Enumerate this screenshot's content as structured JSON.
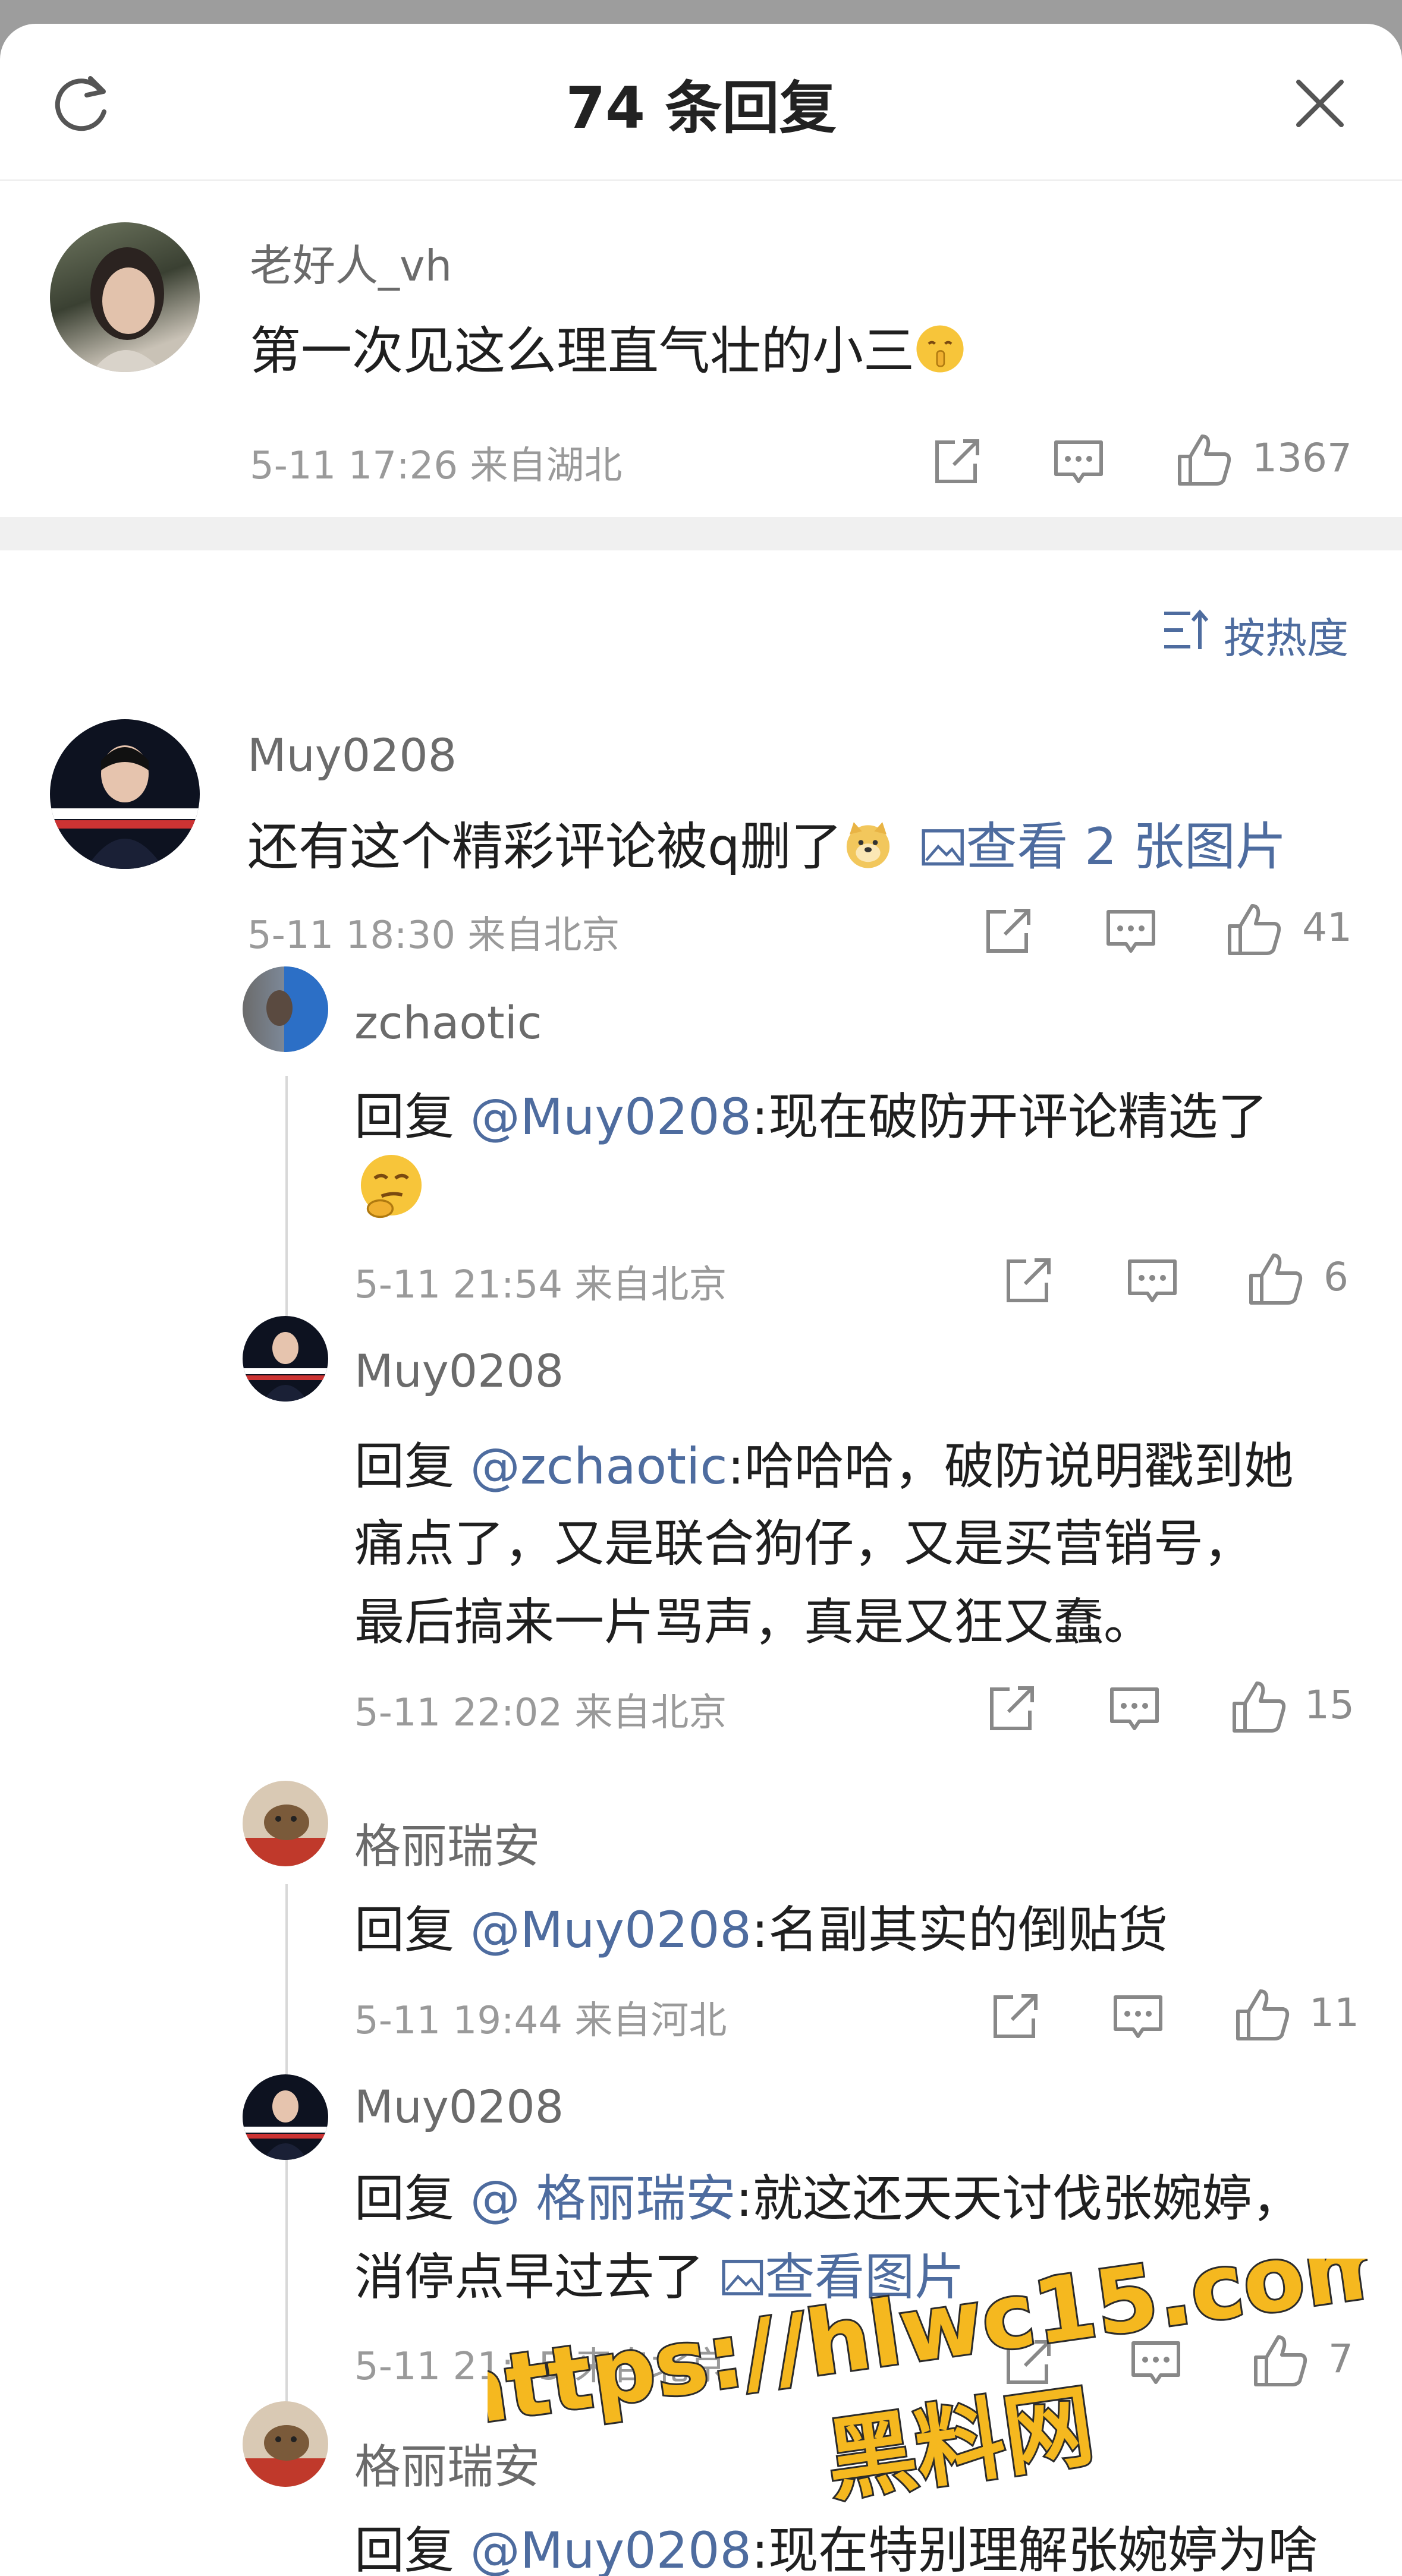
{
  "header": {
    "title": "74 条回复"
  },
  "op": {
    "user": "老好人_vh",
    "text": "第一次见这么理直气壮的小三",
    "emoji": "shush-emoji",
    "time": "5-11 17:26",
    "location": "来自湖北",
    "likes": "1367"
  },
  "sort": {
    "label": "按热度"
  },
  "comments": [
    {
      "user": "Muy0208",
      "text": "还有这个精彩评论被q删了",
      "emoji": "doge-emoji",
      "image_link": "查看 2 张图片",
      "time": "5-11 18:30",
      "location": "来自北京",
      "likes": "41",
      "replies": [
        {
          "user": "zchaotic",
          "prefix": "回复 ",
          "mention": "@Muy0208",
          "text": ":现在破防开评论精选了",
          "emoji": "smirk-emoji",
          "time": "5-11 21:54",
          "location": "来自北京",
          "likes": "6"
        },
        {
          "user": "Muy0208",
          "prefix": "回复 ",
          "mention": "@zchaotic",
          "line1": ":哈哈哈，破防说明戳到她",
          "line2": "痛点了，又是联合狗仔，又是买营销号，",
          "line3": "最后搞来一片骂声，真是又狂又蠢。",
          "time": "5-11 22:02",
          "location": "来自北京",
          "likes": "15"
        }
      ]
    },
    {
      "user": "格丽瑞安",
      "prefix": "回复 ",
      "mention": "@Muy0208",
      "text": ":名副其实的倒贴货",
      "time": "5-11 19:44",
      "location": "来自河北",
      "likes": "11",
      "replies": [
        {
          "user": "Muy0208",
          "prefix": "回复 ",
          "mention": "@ 格丽瑞安",
          "line1": ":就这还天天讨伐张婉婷，",
          "line2": "消停点早过去了 ",
          "image_link": "查看图片",
          "time": "5-11 21:15",
          "location": "来自北京",
          "likes": "7"
        },
        {
          "user": "格丽瑞安",
          "prefix": "回复 ",
          "mention": "@Muy0208",
          "text": ":现在特别理解张婉婷为啥"
        }
      ]
    }
  ],
  "watermark": {
    "line1": "https://hlwc15.com",
    "line2": "黑料网"
  },
  "colors": {
    "link": "#4e6c9f",
    "meta": "#9a9a9a",
    "watermark": "#f5b81f"
  },
  "icons": [
    "refresh-icon",
    "close-icon",
    "share-icon",
    "comment-icon",
    "like-icon",
    "sort-icon",
    "image-icon"
  ]
}
